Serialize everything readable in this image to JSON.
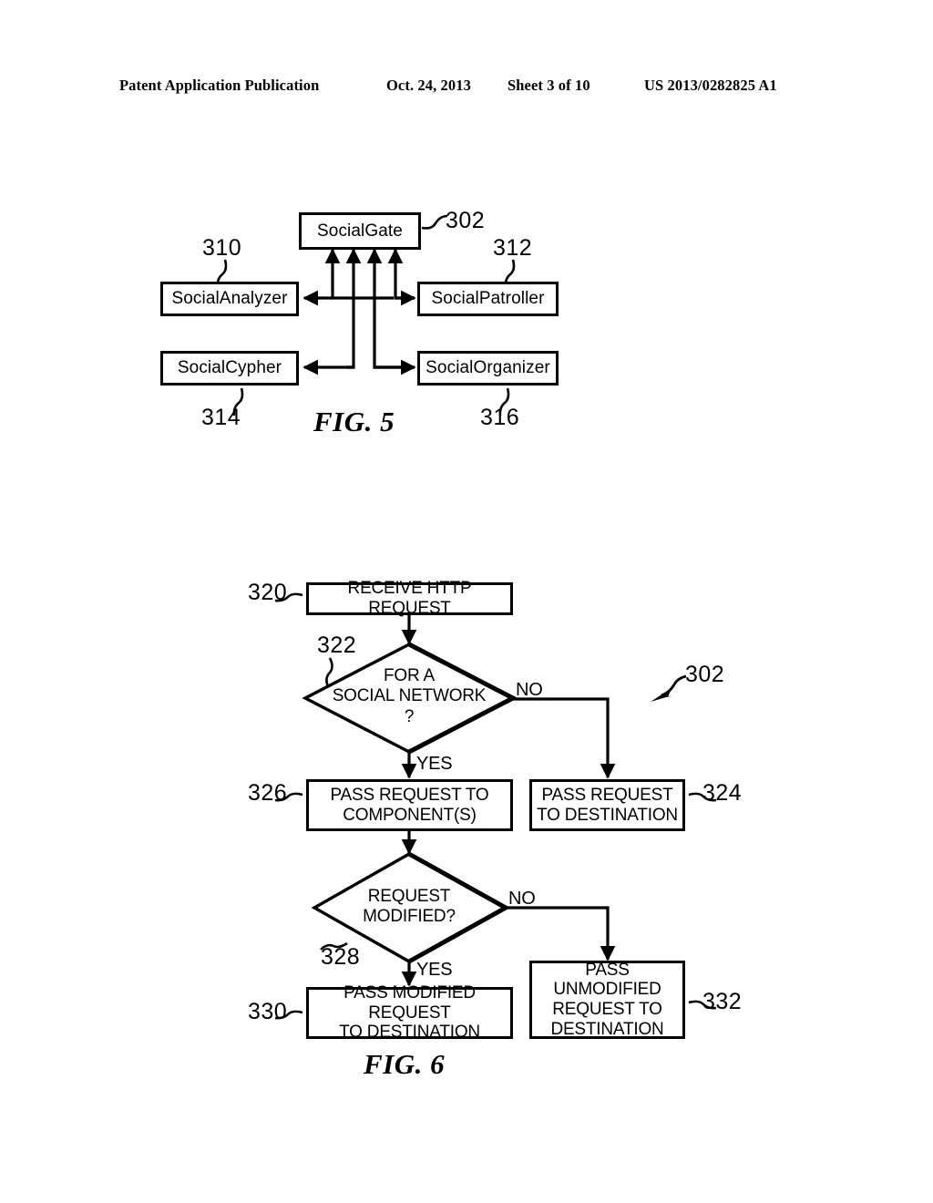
{
  "header": {
    "publication": "Patent Application Publication",
    "date": "Oct. 24, 2013",
    "sheet": "Sheet 3 of 10",
    "patent_number": "US 2013/0282825 A1"
  },
  "figures": [
    {
      "caption": "FIG. 5",
      "type": "block-diagram",
      "nodes": [
        {
          "id": "302",
          "label": "SocialGate",
          "ref": "302"
        },
        {
          "id": "310",
          "label": "SocialAnalyzer",
          "ref": "310"
        },
        {
          "id": "312",
          "label": "SocialPatroller",
          "ref": "312"
        },
        {
          "id": "314",
          "label": "SocialCypher",
          "ref": "314"
        },
        {
          "id": "316",
          "label": "SocialOrganizer",
          "ref": "316"
        }
      ]
    },
    {
      "caption": "FIG. 6",
      "type": "flowchart",
      "ref": "302",
      "nodes": [
        {
          "id": "320",
          "shape": "process",
          "ref": "320",
          "label": "RECEIVE HTTP REQUEST"
        },
        {
          "id": "322",
          "shape": "decision",
          "ref": "322",
          "label": "FOR A\nSOCIAL NETWORK\n?"
        },
        {
          "id": "326",
          "shape": "process",
          "ref": "326",
          "label": "PASS REQUEST TO\nCOMPONENT(S)"
        },
        {
          "id": "324",
          "shape": "process",
          "ref": "324",
          "label": "PASS REQUEST\nTO DESTINATION"
        },
        {
          "id": "328",
          "shape": "decision",
          "ref": "328",
          "label": "REQUEST\nMODIFIED?"
        },
        {
          "id": "330",
          "shape": "process",
          "ref": "330",
          "label": "PASS MODIFIED REQUEST\nTO DESTINATION"
        },
        {
          "id": "332",
          "shape": "process",
          "ref": "332",
          "label": "PASS UNMODIFIED\nREQUEST TO\nDESTINATION"
        }
      ],
      "edge_labels": {
        "d322_no": "NO",
        "d322_yes": "YES",
        "d328_no": "NO",
        "d328_yes": "YES"
      }
    }
  ]
}
